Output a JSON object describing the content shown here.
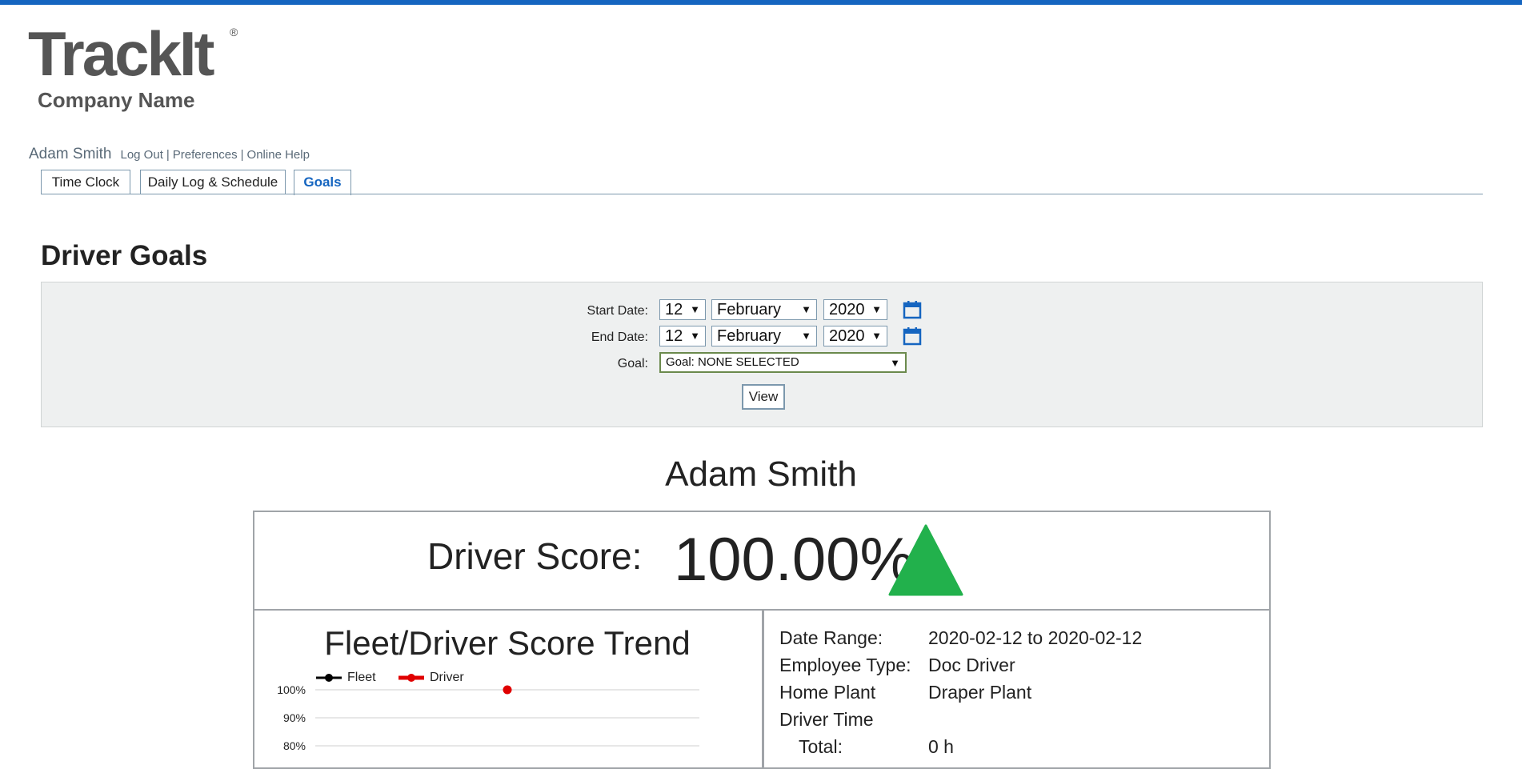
{
  "app": {
    "logo_text": "TrackIt",
    "logo_mark": "®",
    "company_name": "Company Name",
    "accent_color": "#1565c0"
  },
  "user": {
    "name": "Adam Smith",
    "links": [
      "Log Out",
      "Preferences",
      "Online Help"
    ]
  },
  "tabs": [
    {
      "label": "Time Clock",
      "active": false
    },
    {
      "label": "Daily Log & Schedule",
      "active": false
    },
    {
      "label": "Goals",
      "active": true
    }
  ],
  "page": {
    "title": "Driver Goals"
  },
  "filters": {
    "start_label": "Start Date:",
    "start_day": "12",
    "start_month": "February",
    "start_year": "2020",
    "end_label": "End Date:",
    "end_day": "12",
    "end_month": "February",
    "end_year": "2020",
    "goal_label": "Goal:",
    "goal_value": "Goal: NONE SELECTED",
    "view_button": "View",
    "calendar_icon": "calendar-icon"
  },
  "driver": {
    "name": "Adam Smith",
    "score_label": "Driver Score:",
    "score_value": "100.00%",
    "trend_icon": "up-arrow-icon",
    "trend_color": "#22b14c"
  },
  "trend": {
    "title": "Fleet/Driver Score Trend",
    "legend": [
      {
        "name": "Fleet",
        "color": "#000000"
      },
      {
        "name": "Driver",
        "color": "#e00000"
      }
    ]
  },
  "chart_data": {
    "type": "line",
    "title": "Fleet/Driver Score Trend",
    "yticks": [
      "100%",
      "90%",
      "80%"
    ],
    "series": [
      {
        "name": "Fleet",
        "values": []
      },
      {
        "name": "Driver",
        "values": [
          100
        ]
      }
    ],
    "ylim_visible": [
      80,
      100
    ],
    "grid": true,
    "legend_position": "top-left"
  },
  "info": {
    "rows": [
      {
        "label": "Date Range:",
        "value": "2020-02-12 to 2020-02-12"
      },
      {
        "label": "Employee Type:",
        "value": "Doc Driver"
      },
      {
        "label": "Home Plant",
        "value": "Draper Plant"
      },
      {
        "label": "Driver Time",
        "value": ""
      },
      {
        "label": "Total:",
        "value": "0 h"
      }
    ]
  }
}
